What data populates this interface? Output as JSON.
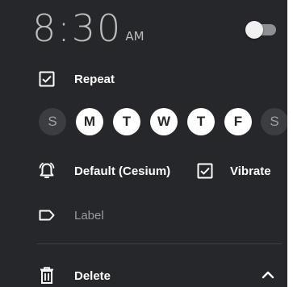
{
  "alarm": {
    "time": "8:30",
    "ampm": "AM",
    "enabled": false
  },
  "repeat": {
    "label": "Repeat",
    "checked": true
  },
  "days": [
    {
      "letter": "S",
      "selected": false
    },
    {
      "letter": "M",
      "selected": true
    },
    {
      "letter": "T",
      "selected": true
    },
    {
      "letter": "W",
      "selected": true
    },
    {
      "letter": "T",
      "selected": true
    },
    {
      "letter": "F",
      "selected": true
    },
    {
      "letter": "S",
      "selected": false
    }
  ],
  "ringtone": {
    "label": "Default (Cesium)",
    "icon": "bell-icon"
  },
  "vibrate": {
    "label": "Vibrate",
    "checked": true
  },
  "label_field": {
    "placeholder": "Label",
    "icon": "label-tag-icon"
  },
  "delete": {
    "label": "Delete",
    "icon": "trash-icon"
  },
  "collapse": {
    "icon": "chevron-up-icon"
  },
  "colors": {
    "background": "#25272b",
    "selected_day": "#ffffff",
    "unselected_day": "#3b3d41",
    "muted_text": "#9a9b9e"
  }
}
